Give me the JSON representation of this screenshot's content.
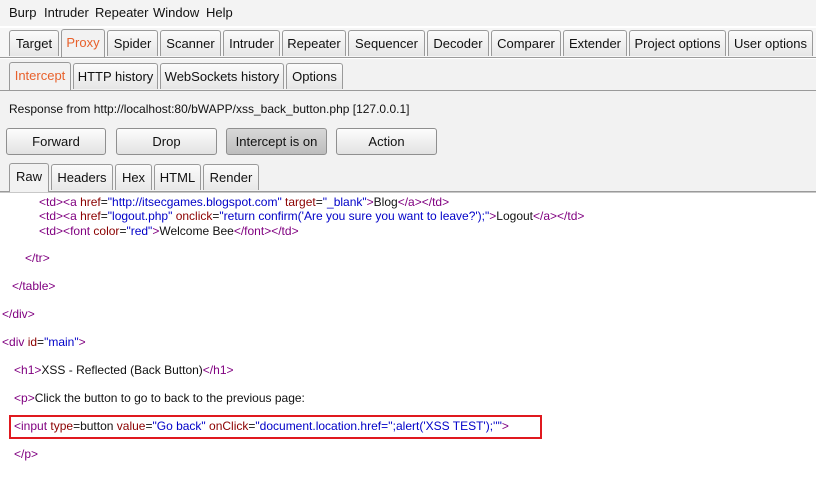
{
  "menu": [
    "Burp",
    "Intruder",
    "Repeater",
    "Window",
    "Help"
  ],
  "main_tabs": [
    "Target",
    "Proxy",
    "Spider",
    "Scanner",
    "Intruder",
    "Repeater",
    "Sequencer",
    "Decoder",
    "Comparer",
    "Extender",
    "Project options",
    "User options"
  ],
  "main_selected": "Proxy",
  "proxy_tabs": [
    "Intercept",
    "HTTP history",
    "WebSockets history",
    "Options"
  ],
  "proxy_selected": "Intercept",
  "response_info": "Response from http://localhost:80/bWAPP/xss_back_button.php  [127.0.0.1]",
  "buttons": [
    "Forward",
    "Drop",
    "Intercept is on",
    "Action"
  ],
  "view_tabs": [
    "Raw",
    "Headers",
    "Hex",
    "HTML",
    "Render"
  ],
  "view_selected": "Raw",
  "code_lines": [
    [
      [
        "<",
        "tg"
      ],
      [
        "td",
        "tg"
      ],
      [
        ">",
        "tg"
      ],
      [
        "<",
        "tg"
      ],
      [
        "a ",
        "tg"
      ],
      [
        "href",
        "at"
      ],
      [
        "=",
        "tx"
      ],
      [
        "\"http://itsecgames.blogspot.com\"",
        "av"
      ],
      [
        " target",
        "at"
      ],
      [
        "=",
        "tx"
      ],
      [
        "\"_blank\"",
        "av"
      ],
      [
        ">",
        "tg"
      ],
      [
        "Blog",
        "tx"
      ],
      [
        "</",
        "tg"
      ],
      [
        "a",
        "tg"
      ],
      [
        ">",
        "tg"
      ],
      [
        "</",
        "tg"
      ],
      [
        "td",
        "tg"
      ],
      [
        ">",
        "tg"
      ]
    ],
    [
      [
        "<",
        "tg"
      ],
      [
        "td",
        "tg"
      ],
      [
        ">",
        "tg"
      ],
      [
        "<",
        "tg"
      ],
      [
        "a ",
        "tg"
      ],
      [
        "href",
        "at"
      ],
      [
        "=",
        "tx"
      ],
      [
        "\"logout.php\"",
        "av"
      ],
      [
        " onclick",
        "at"
      ],
      [
        "=",
        "tx"
      ],
      [
        "\"return confirm('Are you sure you want to leave?');\"",
        "av"
      ],
      [
        ">",
        "tg"
      ],
      [
        "Logout",
        "tx"
      ],
      [
        "</",
        "tg"
      ],
      [
        "a",
        "tg"
      ],
      [
        ">",
        "tg"
      ],
      [
        "</",
        "tg"
      ],
      [
        "td",
        "tg"
      ],
      [
        ">",
        "tg"
      ]
    ],
    [
      [
        "<",
        "tg"
      ],
      [
        "td",
        "tg"
      ],
      [
        ">",
        "tg"
      ],
      [
        "<",
        "tg"
      ],
      [
        "font ",
        "tg"
      ],
      [
        "color",
        "at"
      ],
      [
        "=",
        "tx"
      ],
      [
        "\"red\"",
        "av"
      ],
      [
        ">",
        "tg"
      ],
      [
        "Welcome Bee",
        "tx"
      ],
      [
        "</",
        "tg"
      ],
      [
        "font",
        "tg"
      ],
      [
        ">",
        "tg"
      ],
      [
        "</",
        "tg"
      ],
      [
        "td",
        "tg"
      ],
      [
        ">",
        "tg"
      ]
    ],
    [
      [
        "</",
        "tg"
      ],
      [
        "tr",
        "tg"
      ],
      [
        ">",
        "tg"
      ]
    ],
    [
      [
        "</",
        "tg"
      ],
      [
        "table",
        "tg"
      ],
      [
        ">",
        "tg"
      ]
    ],
    [
      [
        "</",
        "tg"
      ],
      [
        "div",
        "tg"
      ],
      [
        ">",
        "tg"
      ]
    ],
    [
      [
        "<",
        "tg"
      ],
      [
        "div ",
        "tg"
      ],
      [
        "id",
        "at"
      ],
      [
        "=",
        "tx"
      ],
      [
        "\"main\"",
        "av"
      ],
      [
        ">",
        "tg"
      ]
    ],
    [
      [
        "<",
        "tg"
      ],
      [
        "h1",
        "tg"
      ],
      [
        ">",
        "tg"
      ],
      [
        "XSS - Reflected (Back Button)",
        "tx"
      ],
      [
        "</",
        "tg"
      ],
      [
        "h1",
        "tg"
      ],
      [
        ">",
        "tg"
      ]
    ],
    [
      [
        "<",
        "tg"
      ],
      [
        "p",
        "tg"
      ],
      [
        ">",
        "tg"
      ],
      [
        "Click the button to go to back to the previous page:",
        "tx"
      ]
    ],
    [
      [
        "<",
        "tg"
      ],
      [
        "input ",
        "tg"
      ],
      [
        "type",
        "at"
      ],
      [
        "=",
        "tx"
      ],
      [
        "button ",
        "tx"
      ],
      [
        "value",
        "at"
      ],
      [
        "=",
        "tx"
      ],
      [
        "\"Go back\"",
        "av"
      ],
      [
        " onClick",
        "at"
      ],
      [
        "=",
        "tx"
      ],
      [
        "\"document.location.href='';alert('XSS TEST');''\"",
        "av"
      ],
      [
        ">",
        "tg"
      ]
    ],
    [
      [
        "</",
        "tg"
      ],
      [
        "p",
        "tg"
      ],
      [
        ">",
        "tg"
      ]
    ]
  ]
}
